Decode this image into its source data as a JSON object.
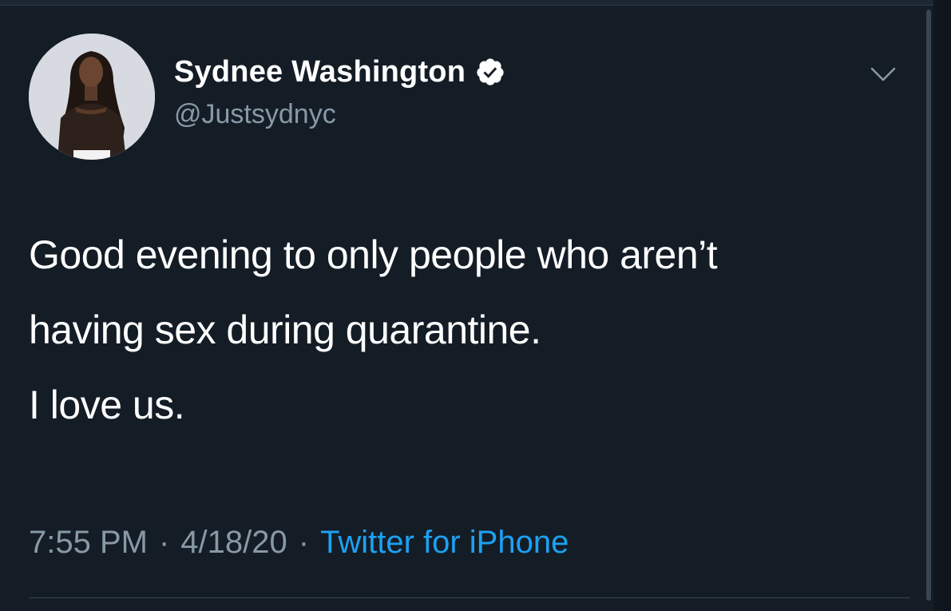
{
  "tweet": {
    "author": {
      "display_name": "Sydnee Washington",
      "handle": "@Justsydnyc",
      "verified": true
    },
    "text_lines": [
      "Good evening to only people who aren’t",
      "having sex during quarantine.",
      "I love us."
    ],
    "time": "7:55 PM",
    "date": "4/18/20",
    "separator": "·",
    "source": "Twitter for iPhone"
  },
  "icons": {
    "verified": "verified-badge-icon",
    "menu": "chevron-down-icon",
    "avatar": "profile-photo"
  },
  "colors": {
    "background": "#141d26",
    "text": "#ffffff",
    "secondary_text": "#8899a6",
    "link": "#1da1f2"
  }
}
